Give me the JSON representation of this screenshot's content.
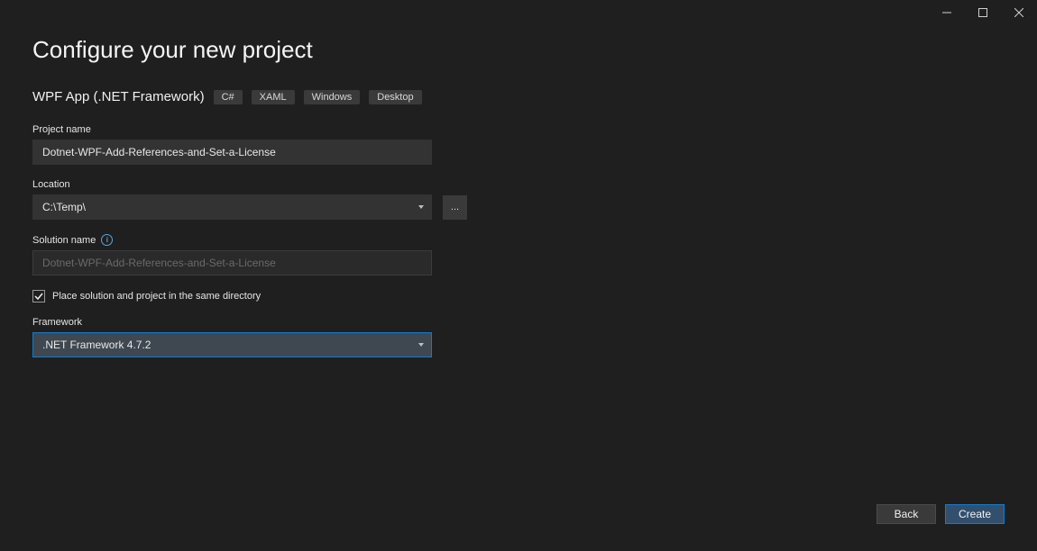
{
  "window": {
    "title": "Configure your new project"
  },
  "template": {
    "name": "WPF App (.NET Framework)",
    "tags": [
      "C#",
      "XAML",
      "Windows",
      "Desktop"
    ]
  },
  "fields": {
    "project_name": {
      "label": "Project name",
      "value": "Dotnet-WPF-Add-References-and-Set-a-License"
    },
    "location": {
      "label": "Location",
      "value": "C:\\Temp\\"
    },
    "solution_name": {
      "label": "Solution name",
      "placeholder": "Dotnet-WPF-Add-References-and-Set-a-License"
    },
    "same_dir": {
      "label": "Place solution and project in the same directory",
      "checked": true
    },
    "framework": {
      "label": "Framework",
      "value": ".NET Framework 4.7.2"
    }
  },
  "buttons": {
    "browse": "...",
    "back": "Back",
    "create": "Create"
  }
}
